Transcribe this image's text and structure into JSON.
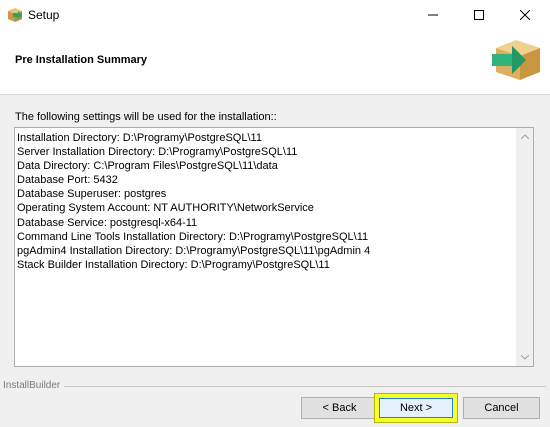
{
  "window": {
    "title": "Setup",
    "icons": {
      "app": "installer-box-icon",
      "minimize": "minimize-icon",
      "maximize": "maximize-icon",
      "close": "close-icon"
    }
  },
  "header": {
    "title": "Pre Installation Summary",
    "logo_icon": "installer-box-arrow-icon"
  },
  "main": {
    "intro": "The following settings will be used for the installation::",
    "lines": [
      "Installation Directory: D:\\Programy\\PostgreSQL\\11",
      "Server Installation Directory: D:\\Programy\\PostgreSQL\\11",
      "Data Directory: C:\\Program Files\\PostgreSQL\\11\\data",
      "Database Port: 5432",
      "Database Superuser: postgres",
      "Operating System Account: NT AUTHORITY\\NetworkService",
      "Database Service: postgresql-x64-11",
      "Command Line Tools Installation Directory: D:\\Programy\\PostgreSQL\\11",
      "pgAdmin4 Installation Directory: D:\\Programy\\PostgreSQL\\11\\pgAdmin 4",
      "Stack Builder Installation Directory: D:\\Programy\\PostgreSQL\\11"
    ]
  },
  "footer": {
    "brand": "InstallBuilder",
    "back_label": "< Back",
    "next_label": "Next >",
    "cancel_label": "Cancel",
    "highlight_color": "#f5ff2a"
  }
}
